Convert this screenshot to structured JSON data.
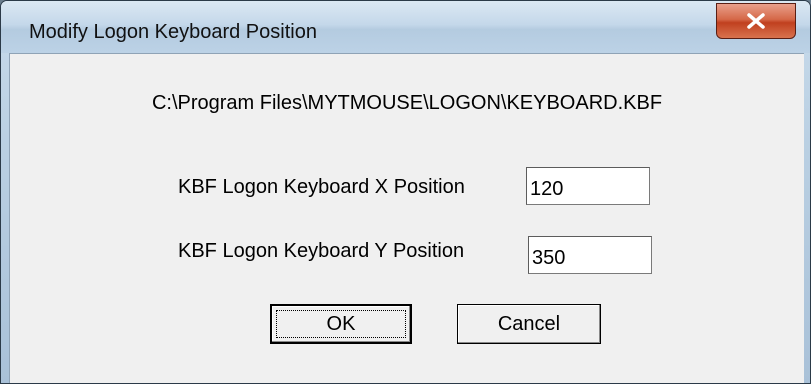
{
  "window": {
    "title": "Modify Logon Keyboard Position"
  },
  "titlebar_buttons": {
    "close_icon": "close-icon",
    "close_color": "#c8462a"
  },
  "dialog": {
    "file_path": "C:\\Program Files\\MYTMOUSE\\LOGON\\KEYBOARD.KBF",
    "x_label": "KBF Logon Keyboard X Position",
    "x_value": "120",
    "y_label": "KBF Logon Keyboard Y Position",
    "y_value": "350"
  },
  "buttons": {
    "ok_label": "OK",
    "cancel_label": "Cancel"
  }
}
